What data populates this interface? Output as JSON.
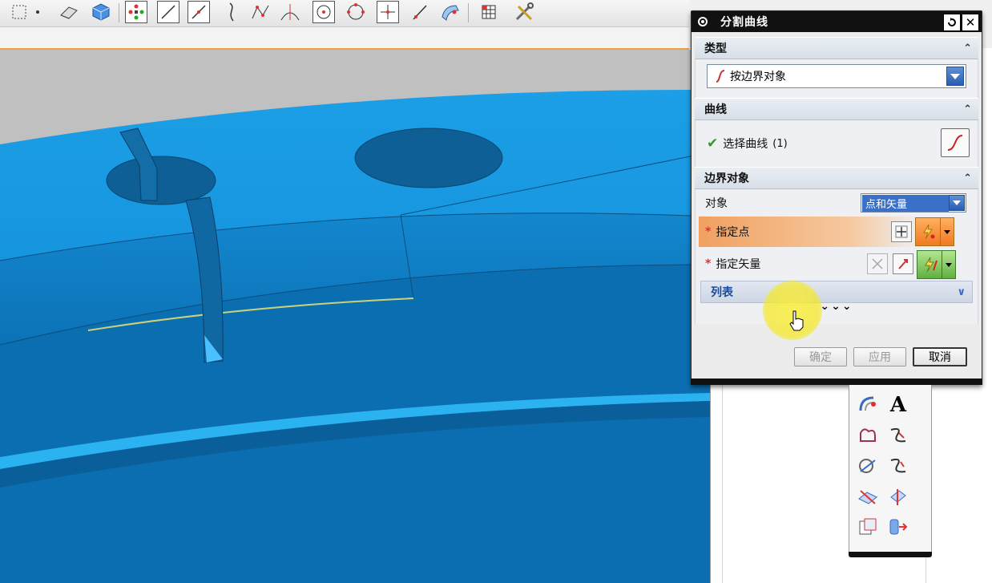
{
  "dialog": {
    "title": "分割曲线",
    "type_section": {
      "header": "类型",
      "selected": "按边界对象"
    },
    "curve_section": {
      "header": "曲线",
      "select_label": "选择曲线",
      "count": "(1)"
    },
    "boundary_section": {
      "header": "边界对象",
      "object_label": "对象",
      "object_value": "点和矢量",
      "point_label": "指定点",
      "vector_label": "指定矢量",
      "list_label": "列表",
      "required_mark": "*"
    },
    "more_glyph": "⌄⌄⌄",
    "buttons": {
      "ok": "确定",
      "apply": "应用",
      "cancel": "取消"
    }
  },
  "float_toolbar": {
    "text_tool_label": "A"
  },
  "colors": {
    "model_blue": "#1a9ee0",
    "model_dark": "#0a6db0",
    "highlight_orange": "#f0a560",
    "dialog_title_bg": "#111111"
  }
}
